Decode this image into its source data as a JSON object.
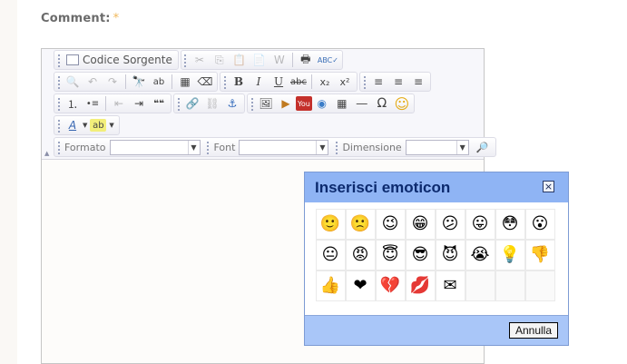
{
  "form": {
    "comment_label": "Comment:",
    "required_marker": "*"
  },
  "toolbar": {
    "source_label": "Codice Sorgente",
    "format_label": "Formato",
    "font_label": "Font",
    "size_label": "Dimensione",
    "format_value": "",
    "font_value": "",
    "size_value": "",
    "buttons": {
      "cut": "✂",
      "copy": "⎘",
      "paste": "📋",
      "paste_text": "📄",
      "paste_word": "W",
      "print": "🖶",
      "spellcheck": "ABC✓",
      "preview": "🔍",
      "undo": "↶",
      "redo": "↷",
      "find": "🔭",
      "replace": "ab",
      "select_all": "▦",
      "remove_format": "⌫",
      "bold": "B",
      "italic": "I",
      "underline": "U",
      "strike": "abc",
      "subscript": "x₂",
      "superscript": "x²",
      "align_left": "≡",
      "align_center": "≡",
      "align_right": "≡",
      "numbered_list": "⒈",
      "bulleted_list": "•≡",
      "outdent": "⇤",
      "indent": "⇥",
      "blockquote": "❝❝",
      "link": "🔗",
      "unlink": "⛓",
      "anchor": "⚓",
      "image": "🖼",
      "flash": "▶",
      "youtube": "You",
      "media": "◉",
      "table": "▦",
      "hr": "―",
      "special_char": "Ω",
      "smiley": "☺",
      "text_color": "A",
      "bg_color": "ab",
      "maximize": "🔎"
    }
  },
  "dialog": {
    "title": "Inserisci emoticon",
    "close": "×",
    "cancel_label": "Annulla",
    "emoticons": [
      {
        "glyph": "🙂",
        "name": "smile"
      },
      {
        "glyph": "🙁",
        "name": "sad"
      },
      {
        "glyph": "😉",
        "name": "wink"
      },
      {
        "glyph": "😁",
        "name": "grin"
      },
      {
        "glyph": "😕",
        "name": "confused"
      },
      {
        "glyph": "😛",
        "name": "tongue"
      },
      {
        "glyph": "😳",
        "name": "embarrassed"
      },
      {
        "glyph": "😮",
        "name": "surprised"
      },
      {
        "glyph": "😐",
        "name": "indecision"
      },
      {
        "glyph": "😡",
        "name": "angry"
      },
      {
        "glyph": "😇",
        "name": "angel"
      },
      {
        "glyph": "😎",
        "name": "cool"
      },
      {
        "glyph": "😈",
        "name": "devil"
      },
      {
        "glyph": "😭",
        "name": "crying"
      },
      {
        "glyph": "💡",
        "name": "lightbulb"
      },
      {
        "glyph": "👎",
        "name": "thumbs-down"
      },
      {
        "glyph": "👍",
        "name": "thumbs-up"
      },
      {
        "glyph": "❤",
        "name": "heart"
      },
      {
        "glyph": "💔",
        "name": "broken-heart"
      },
      {
        "glyph": "💋",
        "name": "kiss"
      },
      {
        "glyph": "✉",
        "name": "envelope"
      }
    ]
  },
  "colors": {
    "dialog_bg": "#8fb4f4",
    "dialog_title": "#0c2a6e",
    "required": "#f0b85a"
  }
}
